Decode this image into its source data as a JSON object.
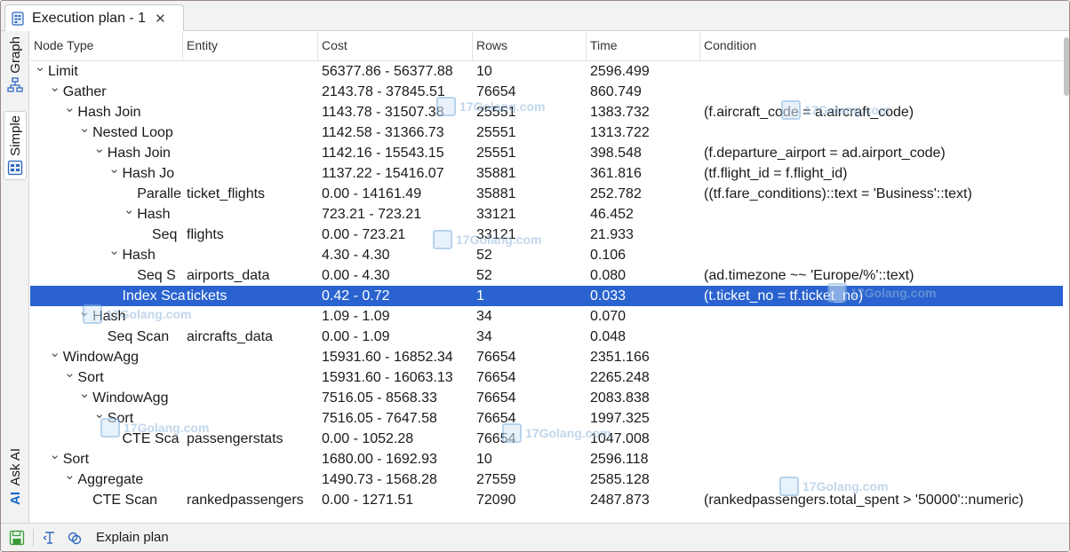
{
  "tab": {
    "title": "Execution plan - 1",
    "close": "✕"
  },
  "left_tabs": {
    "graph": "Graph",
    "simple": "Simple",
    "ask_ai": "Ask AI",
    "ai_mark": "AI"
  },
  "columns": [
    "Node Type",
    "Entity",
    "Cost",
    "Rows",
    "Time",
    "Condition"
  ],
  "rows": [
    {
      "node": "Limit",
      "depth": 0,
      "chev": "down",
      "entity": "",
      "cost": "56377.86 - 56377.88",
      "rows": "10",
      "time": "2596.499",
      "cond": ""
    },
    {
      "node": "Gather",
      "depth": 1,
      "chev": "down",
      "entity": "",
      "cost": "2143.78 - 37845.51",
      "rows": "76654",
      "time": "860.749",
      "cond": ""
    },
    {
      "node": "Hash Join",
      "depth": 2,
      "chev": "down",
      "entity": "",
      "cost": "1143.78 - 31507.38",
      "rows": "25551",
      "time": "1383.732",
      "cond": "(f.aircraft_code = a.aircraft_code)"
    },
    {
      "node": "Nested Loop",
      "depth": 3,
      "chev": "down",
      "entity": "",
      "cost": "1142.58 - 31366.73",
      "rows": "25551",
      "time": "1313.722",
      "cond": ""
    },
    {
      "node": "Hash Join",
      "depth": 4,
      "chev": "down",
      "entity": "",
      "cost": "1142.16 - 15543.15",
      "rows": "25551",
      "time": "398.548",
      "cond": "(f.departure_airport = ad.airport_code)"
    },
    {
      "node": "Hash Jo",
      "depth": 5,
      "chev": "down",
      "entity": "",
      "cost": "1137.22 - 15416.07",
      "rows": "35881",
      "time": "361.816",
      "cond": "(tf.flight_id = f.flight_id)"
    },
    {
      "node": "Paralle",
      "depth": 6,
      "chev": "",
      "entity": "ticket_flights",
      "cost": "0.00 - 14161.49",
      "rows": "35881",
      "time": "252.782",
      "cond": "((tf.fare_conditions)::text = 'Business'::text)"
    },
    {
      "node": "Hash",
      "depth": 6,
      "chev": "down",
      "entity": "",
      "cost": "723.21 - 723.21",
      "rows": "33121",
      "time": "46.452",
      "cond": ""
    },
    {
      "node": "Seq",
      "depth": 7,
      "chev": "",
      "entity": "flights",
      "cost": "0.00 - 723.21",
      "rows": "33121",
      "time": "21.933",
      "cond": ""
    },
    {
      "node": "Hash",
      "depth": 5,
      "chev": "down",
      "entity": "",
      "cost": "4.30 - 4.30",
      "rows": "52",
      "time": "0.106",
      "cond": ""
    },
    {
      "node": "Seq S",
      "depth": 6,
      "chev": "",
      "entity": "airports_data",
      "cost": "0.00 - 4.30",
      "rows": "52",
      "time": "0.080",
      "cond": "(ad.timezone ~~ 'Europe/%'::text)"
    },
    {
      "node": "Index Scar",
      "depth": 5,
      "chev": "",
      "entity": "tickets",
      "cost": "0.42 - 0.72",
      "rows": "1",
      "time": "0.033",
      "cond": "(t.ticket_no = tf.ticket_no)",
      "selected": true
    },
    {
      "node": "Hash",
      "depth": 3,
      "chev": "down",
      "entity": "",
      "cost": "1.09 - 1.09",
      "rows": "34",
      "time": "0.070",
      "cond": ""
    },
    {
      "node": "Seq Scan",
      "depth": 4,
      "chev": "",
      "entity": "aircrafts_data",
      "cost": "0.00 - 1.09",
      "rows": "34",
      "time": "0.048",
      "cond": ""
    },
    {
      "node": "WindowAgg",
      "depth": 1,
      "chev": "down",
      "entity": "",
      "cost": "15931.60 - 16852.34",
      "rows": "76654",
      "time": "2351.166",
      "cond": ""
    },
    {
      "node": "Sort",
      "depth": 2,
      "chev": "down",
      "entity": "",
      "cost": "15931.60 - 16063.13",
      "rows": "76654",
      "time": "2265.248",
      "cond": ""
    },
    {
      "node": "WindowAgg",
      "depth": 3,
      "chev": "down",
      "entity": "",
      "cost": "7516.05 - 8568.33",
      "rows": "76654",
      "time": "2083.838",
      "cond": ""
    },
    {
      "node": "Sort",
      "depth": 4,
      "chev": "down",
      "entity": "",
      "cost": "7516.05 - 7647.58",
      "rows": "76654",
      "time": "1997.325",
      "cond": ""
    },
    {
      "node": "CTE Sca",
      "depth": 5,
      "chev": "",
      "entity": "passengerstats",
      "cost": "0.00 - 1052.28",
      "rows": "76654",
      "time": "1047.008",
      "cond": ""
    },
    {
      "node": "Sort",
      "depth": 1,
      "chev": "down",
      "entity": "",
      "cost": "1680.00 - 1692.93",
      "rows": "10",
      "time": "2596.118",
      "cond": ""
    },
    {
      "node": "Aggregate",
      "depth": 2,
      "chev": "down",
      "entity": "",
      "cost": "1490.73 - 1568.28",
      "rows": "27559",
      "time": "2585.128",
      "cond": ""
    },
    {
      "node": "CTE Scan",
      "depth": 3,
      "chev": "",
      "entity": "rankedpassengers",
      "cost": "0.00 - 1271.51",
      "rows": "72090",
      "time": "2487.873",
      "cond": "(rankedpassengers.total_spent > '50000'::numeric)"
    }
  ],
  "bottom": {
    "explain_label": "Explain plan"
  },
  "colors": {
    "selection": "#2a63cf",
    "accent": "#1b6ac9",
    "save_green": "#3a9a3a"
  },
  "watermark": "17Golang.com",
  "icons": [
    "plan-tab-icon",
    "graph-view-icon",
    "simple-view-icon",
    "save-icon",
    "text-cursor-icon",
    "refresh-link-icon",
    "chevron-down-icon"
  ]
}
